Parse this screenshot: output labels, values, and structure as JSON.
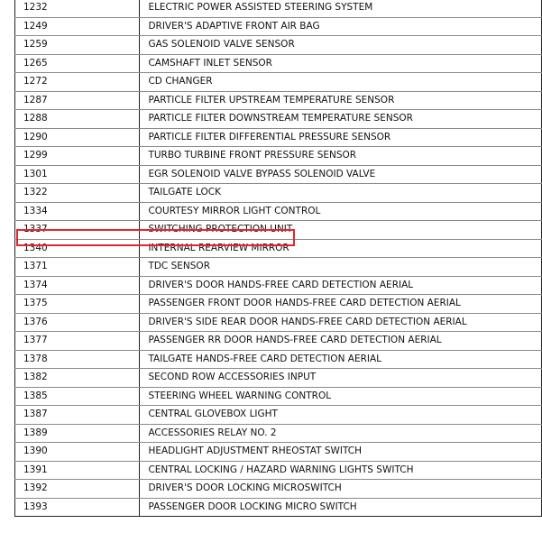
{
  "rows": [
    {
      "code": "1232",
      "description": "ELECTRIC POWER ASSISTED STEERING SYSTEM"
    },
    {
      "code": "1249",
      "description": "DRIVER'S ADAPTIVE FRONT AIR BAG"
    },
    {
      "code": "1259",
      "description": "GAS SOLENOID VALVE SENSOR"
    },
    {
      "code": "1265",
      "description": "CAMSHAFT INLET SENSOR"
    },
    {
      "code": "1272",
      "description": "CD CHANGER"
    },
    {
      "code": "1287",
      "description": "PARTICLE FILTER UPSTREAM TEMPERATURE SENSOR"
    },
    {
      "code": "1288",
      "description": "PARTICLE FILTER DOWNSTREAM TEMPERATURE SENSOR"
    },
    {
      "code": "1290",
      "description": "PARTICLE FILTER DIFFERENTIAL PRESSURE SENSOR"
    },
    {
      "code": "1299",
      "description": "TURBO TURBINE FRONT PRESSURE SENSOR"
    },
    {
      "code": "1301",
      "description": "EGR SOLENOID VALVE BYPASS SOLENOID VALVE"
    },
    {
      "code": "1322",
      "description": "TAILGATE LOCK"
    },
    {
      "code": "1334",
      "description": "COURTESY MIRROR LIGHT CONTROL"
    },
    {
      "code": "1337",
      "description": "SWITCHING PROTECTION UNIT"
    },
    {
      "code": "1340",
      "description": "INTERNAL REARVIEW MIRROR"
    },
    {
      "code": "1371",
      "description": "TDC SENSOR"
    },
    {
      "code": "1374",
      "description": "DRIVER'S DOOR HANDS-FREE CARD DETECTION AERIAL"
    },
    {
      "code": "1375",
      "description": "PASSENGER FRONT DOOR HANDS-FREE CARD DETECTION AERIAL"
    },
    {
      "code": "1376",
      "description": "DRIVER'S SIDE REAR DOOR HANDS-FREE CARD DETECTION AERIAL"
    },
    {
      "code": "1377",
      "description": "PASSENGER RR DOOR HANDS-FREE CARD DETECTION AERIAL"
    },
    {
      "code": "1378",
      "description": "TAILGATE HANDS-FREE CARD DETECTION AERIAL"
    },
    {
      "code": "1382",
      "description": "SECOND ROW ACCESSORIES INPUT"
    },
    {
      "code": "1385",
      "description": "STEERING WHEEL WARNING CONTROL"
    },
    {
      "code": "1387",
      "description": "CENTRAL GLOVEBOX LIGHT"
    },
    {
      "code": "1389",
      "description": "ACCESSORIES RELAY NO. 2"
    },
    {
      "code": "1390",
      "description": "HEADLIGHT ADJUSTMENT RHEOSTAT SWITCH"
    },
    {
      "code": "1391",
      "description": "CENTRAL LOCKING / HAZARD WARNING LIGHTS SWITCH"
    },
    {
      "code": "1392",
      "description": "DRIVER'S DOOR LOCKING MICROSWITCH"
    },
    {
      "code": "1393",
      "description": "PASSENGER DOOR LOCKING MICRO SWITCH"
    }
  ],
  "highlighted_code": "1337",
  "highlight_color": "#e0282e"
}
